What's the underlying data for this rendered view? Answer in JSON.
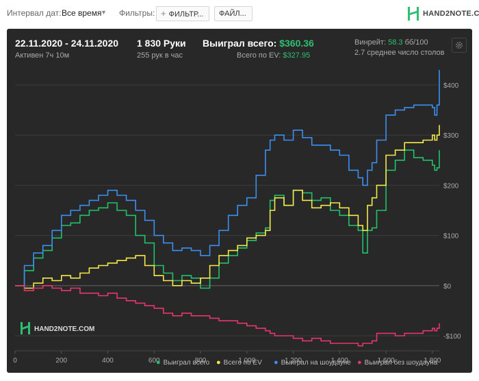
{
  "toolbar": {
    "interval_label": "Интервал дат:",
    "interval_value": "Все время",
    "filters_label": "Фильтры:",
    "filter_button": "ФИЛЬТР...",
    "file_button": "ФАЙЛ..."
  },
  "brand": {
    "name": "HAND2NOTE.COM",
    "color": "#2fbf71"
  },
  "summary": {
    "date_range": "22.11.2020 - 24.11.2020",
    "active": "Активен 7ч 10м",
    "hands": "1 830 Руки",
    "hands_per_hour": "255 рук в час",
    "won_label": "Выиграл всего:",
    "won_value": "$360.36",
    "ev_label": "Всего по EV:",
    "ev_value": "$327.95",
    "rake_label": "Винрейт:",
    "rake_value": "58.3",
    "rake_unit": "бб/100",
    "tables": "2.7 среднее число столов"
  },
  "chart_data": {
    "type": "line",
    "x_ticks": [
      "0",
      "200",
      "400",
      "600",
      "800",
      "1 000",
      "1 200",
      "1 400",
      "1 600",
      "1 800"
    ],
    "y_ticks": [
      "-$100",
      "$0",
      "$100",
      "$200",
      "$300",
      "$400"
    ],
    "xlim": [
      0,
      1830
    ],
    "ylim": [
      -130,
      430
    ],
    "grid": true,
    "legend_position": "bottom",
    "watermark": "HAND2NOTE.COM",
    "series": [
      {
        "name": "Выиграл всего",
        "color": "#22c26b",
        "x": [
          0,
          40,
          80,
          120,
          160,
          200,
          240,
          280,
          320,
          360,
          400,
          440,
          480,
          520,
          560,
          600,
          640,
          680,
          720,
          760,
          800,
          840,
          880,
          920,
          960,
          1000,
          1040,
          1080,
          1100,
          1120,
          1160,
          1200,
          1240,
          1280,
          1320,
          1360,
          1400,
          1440,
          1480,
          1500,
          1520,
          1540,
          1560,
          1600,
          1640,
          1680,
          1720,
          1760,
          1800,
          1810,
          1820,
          1830
        ],
        "y": [
          0,
          30,
          55,
          70,
          95,
          120,
          125,
          140,
          150,
          155,
          165,
          150,
          140,
          100,
          85,
          40,
          25,
          10,
          20,
          15,
          -5,
          15,
          45,
          60,
          75,
          90,
          105,
          115,
          170,
          180,
          160,
          190,
          185,
          170,
          175,
          150,
          140,
          120,
          110,
          65,
          110,
          115,
          150,
          230,
          250,
          270,
          255,
          250,
          240,
          230,
          235,
          270
        ]
      },
      {
        "name": "Всего по EV",
        "color": "#f4ea4a",
        "x": [
          0,
          40,
          80,
          120,
          160,
          200,
          240,
          280,
          320,
          360,
          400,
          440,
          480,
          520,
          560,
          600,
          640,
          680,
          720,
          760,
          800,
          840,
          880,
          920,
          960,
          1000,
          1040,
          1080,
          1100,
          1120,
          1160,
          1200,
          1240,
          1280,
          1320,
          1360,
          1400,
          1440,
          1480,
          1500,
          1520,
          1540,
          1560,
          1600,
          1640,
          1680,
          1720,
          1760,
          1800,
          1810,
          1820,
          1830
        ],
        "y": [
          0,
          -5,
          5,
          15,
          10,
          20,
          15,
          25,
          35,
          40,
          45,
          50,
          55,
          60,
          40,
          20,
          10,
          0,
          10,
          5,
          15,
          40,
          60,
          70,
          80,
          95,
          100,
          110,
          150,
          175,
          160,
          190,
          170,
          155,
          160,
          165,
          155,
          140,
          120,
          110,
          160,
          175,
          200,
          260,
          270,
          285,
          285,
          290,
          300,
          290,
          300,
          320
        ]
      },
      {
        "name": "Выиграл на шоудауне",
        "color": "#3b8ff2",
        "x": [
          0,
          40,
          80,
          120,
          160,
          200,
          240,
          280,
          320,
          360,
          400,
          440,
          480,
          520,
          560,
          600,
          640,
          680,
          720,
          760,
          800,
          840,
          880,
          920,
          960,
          1000,
          1040,
          1080,
          1100,
          1120,
          1160,
          1200,
          1240,
          1280,
          1320,
          1360,
          1400,
          1440,
          1480,
          1500,
          1520,
          1540,
          1560,
          1600,
          1640,
          1680,
          1720,
          1760,
          1800,
          1810,
          1820,
          1830
        ],
        "y": [
          0,
          40,
          65,
          80,
          110,
          140,
          150,
          160,
          170,
          180,
          190,
          180,
          170,
          150,
          130,
          100,
          85,
          70,
          75,
          70,
          60,
          80,
          110,
          140,
          160,
          175,
          220,
          270,
          290,
          300,
          290,
          310,
          295,
          280,
          280,
          270,
          260,
          230,
          215,
          200,
          230,
          245,
          290,
          340,
          350,
          355,
          360,
          360,
          355,
          340,
          360,
          430
        ]
      },
      {
        "name": "Выиграл без шоудауна",
        "color": "#e8356e",
        "x": [
          0,
          40,
          80,
          120,
          160,
          200,
          240,
          280,
          320,
          360,
          400,
          440,
          480,
          520,
          560,
          600,
          640,
          680,
          720,
          760,
          800,
          840,
          880,
          920,
          960,
          1000,
          1040,
          1080,
          1100,
          1120,
          1160,
          1200,
          1240,
          1280,
          1320,
          1360,
          1400,
          1440,
          1480,
          1500,
          1520,
          1540,
          1560,
          1600,
          1640,
          1680,
          1720,
          1760,
          1800,
          1810,
          1820,
          1830
        ],
        "y": [
          0,
          -10,
          -5,
          0,
          -5,
          -10,
          -5,
          -15,
          -15,
          -20,
          -15,
          -25,
          -30,
          -35,
          -40,
          -45,
          -55,
          -60,
          -55,
          -60,
          -60,
          -65,
          -70,
          -70,
          -75,
          -80,
          -85,
          -90,
          -95,
          -100,
          -100,
          -105,
          -110,
          -105,
          -110,
          -115,
          -115,
          -115,
          -120,
          -115,
          -115,
          -110,
          -95,
          -95,
          -100,
          -95,
          -95,
          -90,
          -85,
          -90,
          -85,
          -75
        ]
      }
    ]
  }
}
